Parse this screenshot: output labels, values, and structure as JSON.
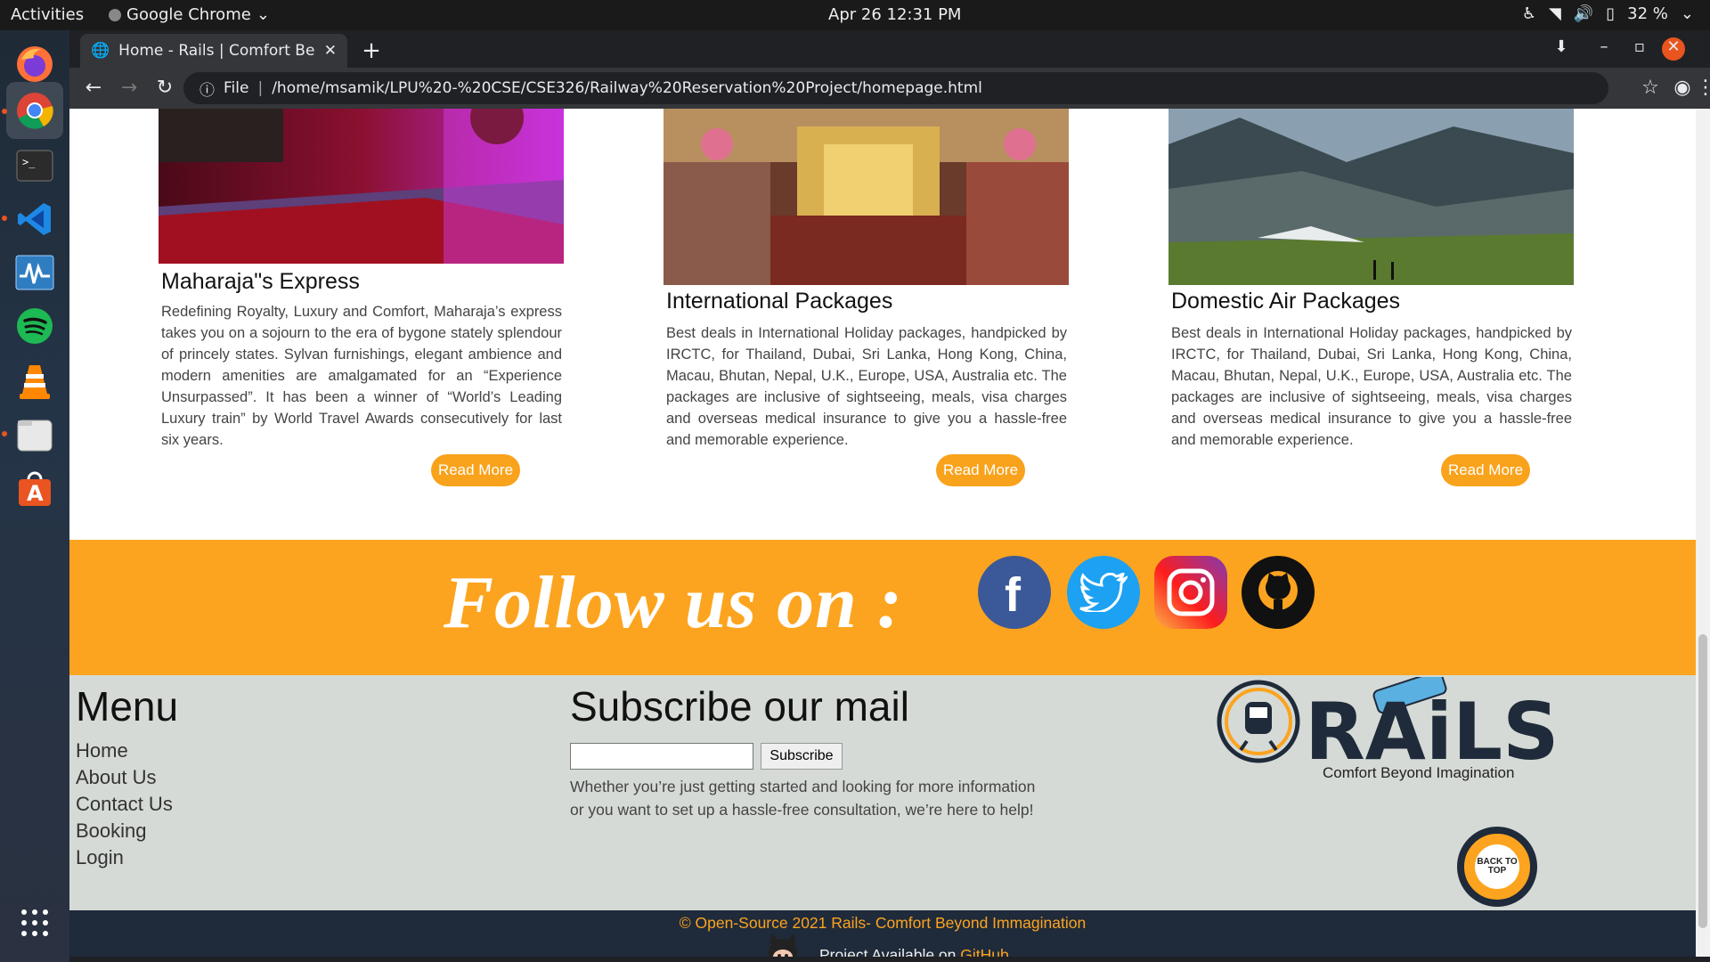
{
  "system": {
    "activities": "Activities",
    "app_name": "Google Chrome",
    "clock": "Apr 26  12:31 PM",
    "battery": "32 %"
  },
  "browser": {
    "tab_title": "Home - Rails | Comfort Be",
    "url_scheme": "File",
    "url": "/home/msamik/LPU%20-%20CSE/CSE326/Railway%20Reservation%20Project/homepage.html"
  },
  "cards": [
    {
      "title": "Maharaja\"s Express",
      "text": "Redefining Royalty, Luxury and Comfort, Maharaja’s express takes you on a sojourn to the era of bygone stately splendour of princely states. Sylvan furnishings, elegant ambience and modern amenities are amalgamated for an “Experience Unsurpassed”. It has been a winner of “World’s Leading Luxury train” by World Travel Awards consecutively for last six years.",
      "button": "Read More"
    },
    {
      "title": "International Packages",
      "text": "Best deals in International Holiday packages, handpicked by IRCTC, for Thailand, Dubai, Sri Lanka, Hong Kong, China, Macau, Bhutan, Nepal, U.K., Europe, USA, Australia etc. The packages are inclusive of sightseeing, meals, visa charges and overseas medical insurance to give you a hassle-free and memorable experience.",
      "button": "Read More"
    },
    {
      "title": "Domestic Air Packages",
      "text": "Best deals in International Holiday packages, handpicked by IRCTC, for Thailand, Dubai, Sri Lanka, Hong Kong, China, Macau, Bhutan, Nepal, U.K., Europe, USA, Australia etc. The packages are inclusive of sightseeing, meals, visa charges and overseas medical insurance to give you a hassle-free and memorable experience.",
      "button": "Read More"
    }
  ],
  "follow": {
    "heading": "Follow us on :",
    "icons": [
      "facebook-icon",
      "twitter-icon",
      "instagram-icon",
      "github-icon"
    ]
  },
  "footer": {
    "menu_title": "Menu",
    "menu": [
      "Home",
      "About Us",
      "Contact Us",
      "Booking",
      "Login"
    ],
    "subscribe_title": "Subscribe our mail",
    "email_value": "",
    "subscribe_button": "Subscribe",
    "subscribe_text": "Whether you’re just getting started and looking for more information or you want to set up a hassle-free consultation, we’re here to help!",
    "logo_text": "RAiLS",
    "logo_tagline": "Comfort Beyond Imagination",
    "back_to_top": "BACK TO TOP"
  },
  "bottom": {
    "copyright": "© Open-Source 2021 Rails- Comfort Beyond Immagination",
    "project_prefix": "Project Available on ",
    "project_link": "GitHub"
  },
  "colors": {
    "accent": "#fca41f",
    "dark": "#1f2a3a",
    "footer_bg": "#d5dad6"
  }
}
